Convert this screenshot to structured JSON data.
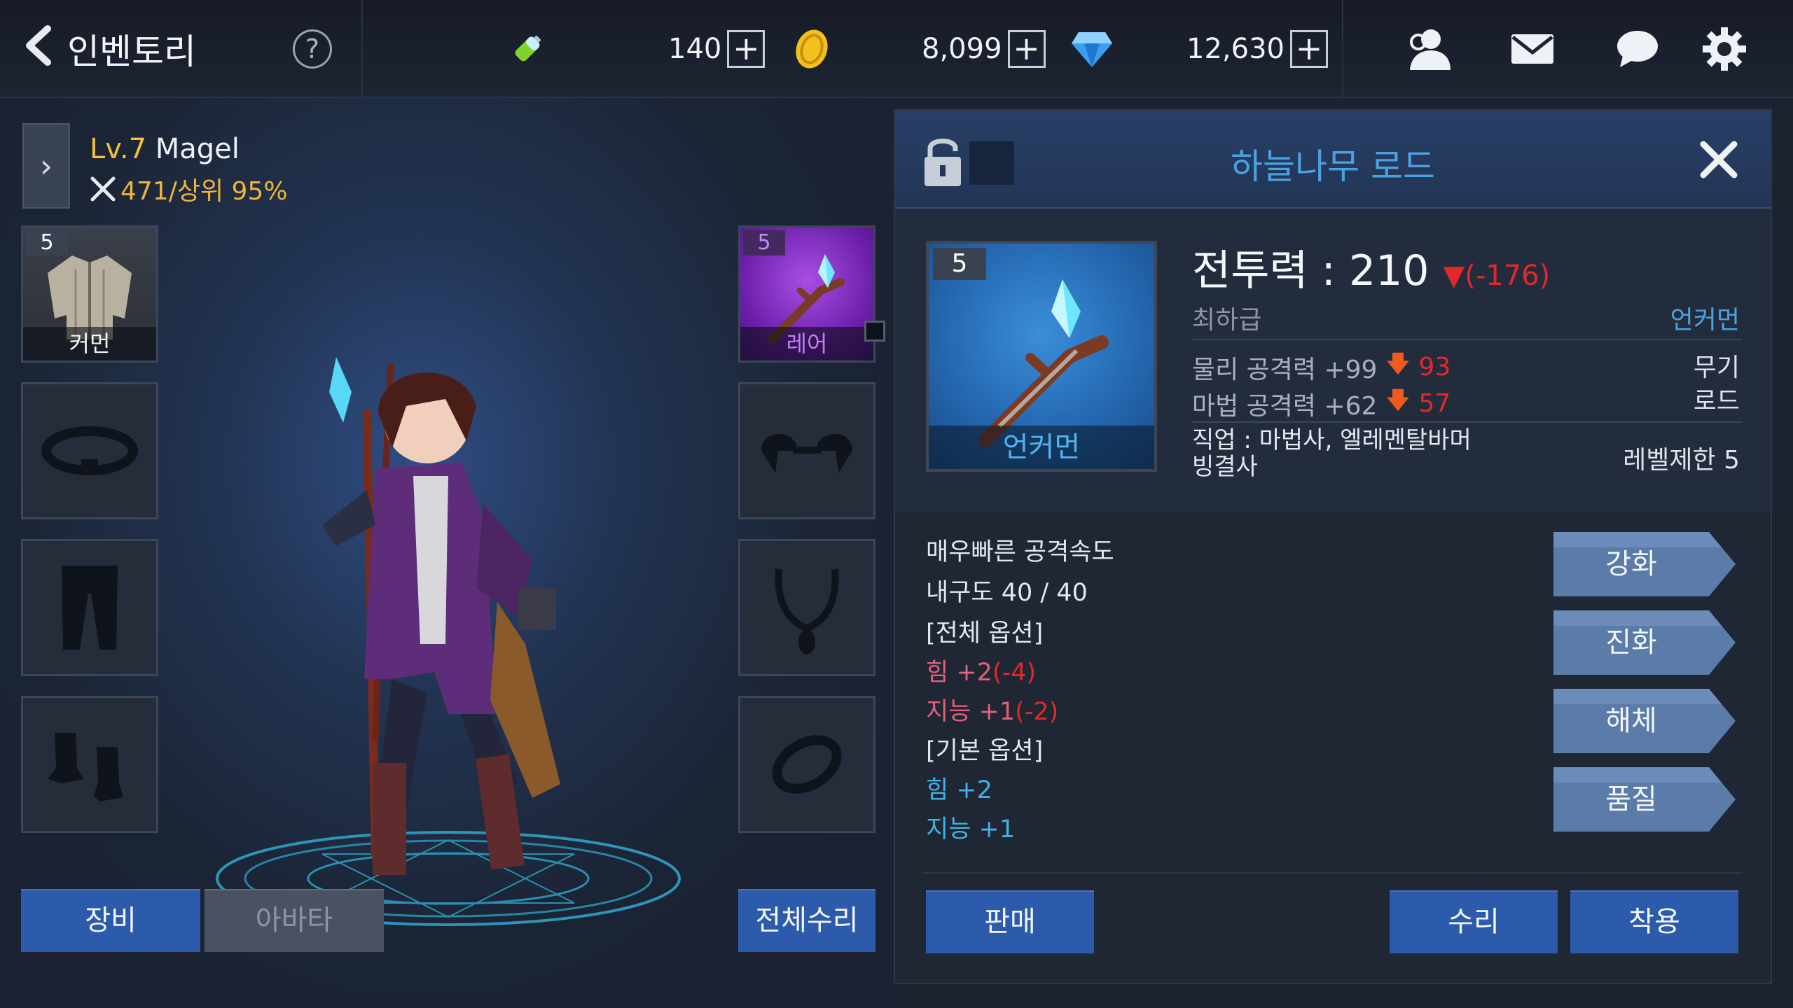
{
  "topbar": {
    "title": "인벤토리",
    "help_label": "?",
    "stamina": "140",
    "gold": "8,099",
    "gems": "12,630",
    "plus": "+"
  },
  "character": {
    "level": "Lv.7",
    "name": "Magel",
    "power": "471/상위 95%"
  },
  "left_slots": {
    "armor_level": "5",
    "armor_grade": "커먼",
    "weapon_level": "5",
    "weapon_grade": "레어"
  },
  "left_buttons": {
    "equip": "장비",
    "avatar": "아바타",
    "repair_all": "전체수리"
  },
  "item": {
    "name": "하늘나무 로드",
    "level": "5",
    "grade_label": "언커먼",
    "combat_power": "전투력 : 210",
    "cp_change": "▼(-176)",
    "quality": "최하급",
    "rarity": "언커먼",
    "stat1": "물리 공격력 +99",
    "stat1_diff": "93",
    "stat2": "마법 공격력 +62",
    "stat2_diff": "57",
    "type_main": "무기",
    "type_sub": "로드",
    "job_line1": "직업 : 마법사, 엘레멘탈바머",
    "job_line2": "빙결사",
    "level_req": "레벨제한 5"
  },
  "options": {
    "speed": "매우빠른 공격속도",
    "durability": "내구도 40 / 40",
    "all_header": "[전체 옵션]",
    "all_str": "힘 +2",
    "all_str_diff": "(-4)",
    "all_int": "지능 +1",
    "all_int_diff": "(-2)",
    "base_header": "[기본 옵션]",
    "base_str": "힘 +2",
    "base_int": "지능 +1"
  },
  "actions": {
    "enhance": "강화",
    "evolve": "진화",
    "dismantle": "해체",
    "quality": "품질",
    "sell": "판매",
    "repair": "수리",
    "equip": "착용"
  },
  "colors": {
    "accent_blue": "#2d5bab",
    "title_blue": "#4aa3e0",
    "loss_red": "#e02a2a",
    "gold": "#f2c13b"
  },
  "icons": [
    "back-chevron-icon",
    "help-icon",
    "stamina-battery-icon",
    "gold-coin-icon",
    "gem-icon",
    "friends-icon",
    "mail-icon",
    "chat-icon",
    "settings-gear-icon",
    "unlock-icon",
    "close-icon"
  ]
}
